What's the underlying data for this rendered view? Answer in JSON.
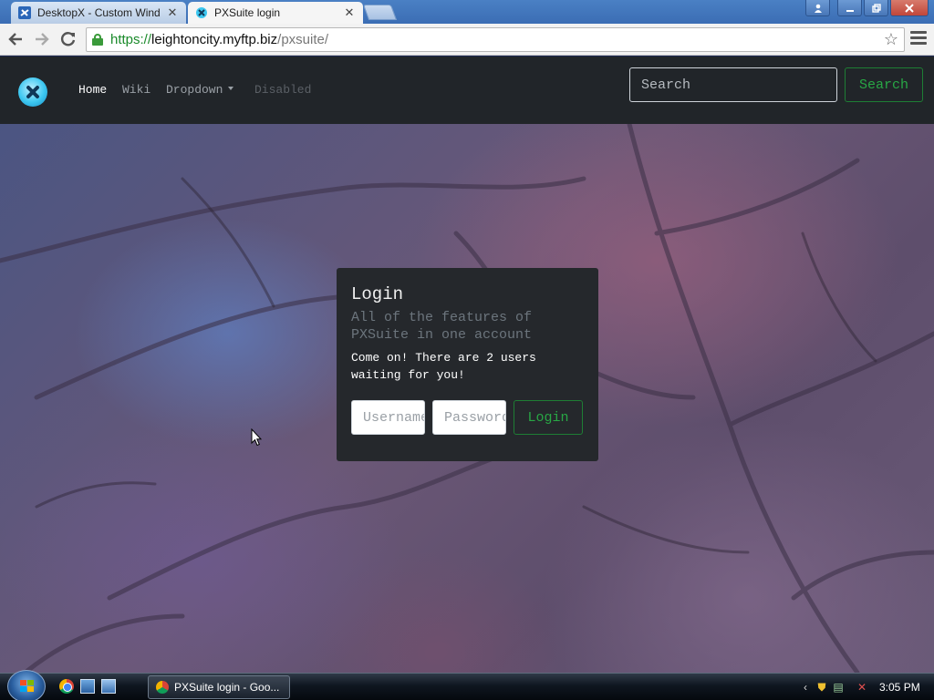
{
  "browser": {
    "tabs": [
      {
        "label": "DesktopX - Custom Wind",
        "active": false,
        "favicon": "desktopx-icon"
      },
      {
        "label": "PXSuite login",
        "active": true,
        "favicon": "pxsuite-icon"
      }
    ],
    "address": {
      "scheme": "https://",
      "host": "leightoncity.myftp.biz",
      "path": "/pxsuite/"
    },
    "icons": {
      "back": "back-arrow-icon",
      "forward": "forward-arrow-icon",
      "reload": "reload-icon",
      "bookmark": "star-icon",
      "menu": "hamburger-menu-icon",
      "secure": "lock-icon"
    }
  },
  "navbar": {
    "links": [
      {
        "label": "Home",
        "state": "active"
      },
      {
        "label": "Wiki",
        "state": "normal"
      },
      {
        "label": "Dropdown",
        "state": "normal"
      },
      {
        "label": "Disabled",
        "state": "disabled"
      }
    ],
    "search_placeholder": "Search",
    "search_button": "Search"
  },
  "login_card": {
    "title": "Login",
    "subtitle": "All of the features of PXSuite in one account",
    "message": "Come on! There are 2 users waiting for you!",
    "username_placeholder": "Username",
    "password_placeholder": "Password",
    "login_button": "Login"
  },
  "taskbar": {
    "window_button": "PXSuite login - Goo...",
    "clock": "3:05 PM"
  },
  "colors": {
    "navbar_bg": "#212529",
    "card_bg": "#25282c",
    "success": "#28a745",
    "muted": "#6c757d"
  }
}
